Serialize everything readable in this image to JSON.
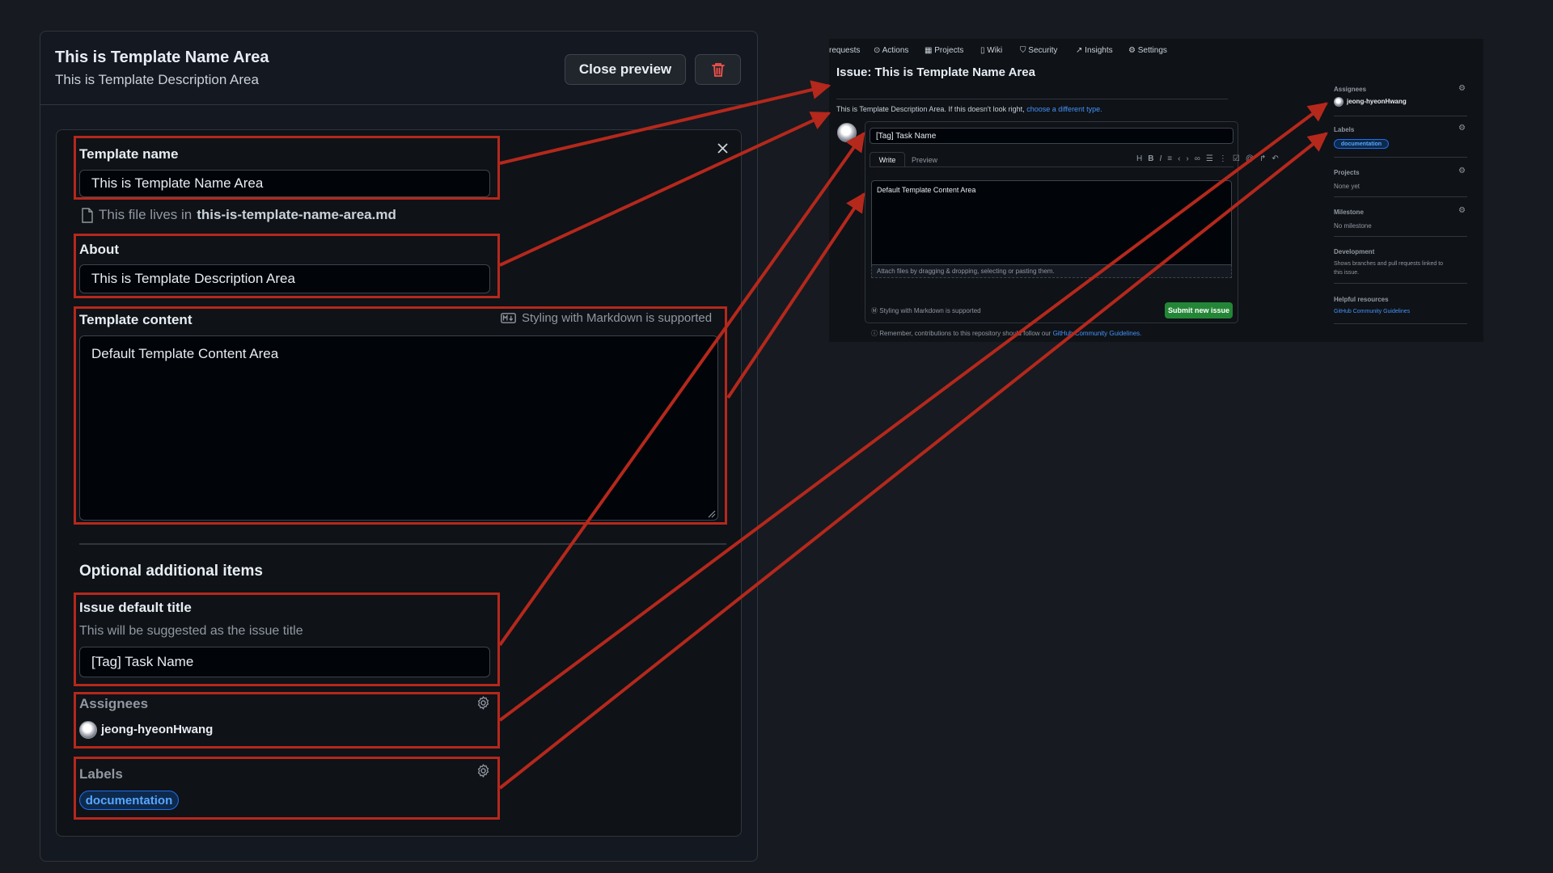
{
  "editor": {
    "title": "This is Template Name Area",
    "description": "This is Template Description Area",
    "close_preview_label": "Close preview",
    "template_name_label": "Template name",
    "template_name_value": "This is Template Name Area",
    "file_prefix": "This file lives in",
    "file_name": "this-is-template-name-area.md",
    "about_label": "About",
    "about_value": "This is Template Description Area",
    "content_label": "Template content",
    "markdown_note": "Styling with Markdown is supported",
    "content_value": "Default Template Content Area",
    "optional_heading": "Optional additional items",
    "issue_title_label": "Issue default title",
    "issue_title_hint": "This will be suggested as the issue title",
    "issue_title_value": "[Tag] Task Name",
    "assignees_label": "Assignees",
    "assignee_name": "jeong-hyeonHwang",
    "labels_label": "Labels",
    "label_chip": "documentation"
  },
  "preview": {
    "nav": [
      "requests",
      "Actions",
      "Projects",
      "Wiki",
      "Security",
      "Insights",
      "Settings"
    ],
    "issue_heading": "Issue: This is Template Name Area",
    "desc_text": "This is Template Description Area. If this doesn't look right,",
    "desc_link": "choose a different type.",
    "title_value": "[Tag] Task Name",
    "tab_write": "Write",
    "tab_preview": "Preview",
    "body_value": "Default Template Content Area",
    "attach_text": "Attach files by dragging & dropping, selecting or pasting them.",
    "markdown_note": "Styling with Markdown is supported",
    "submit_label": "Submit new issue",
    "remember_text": "Remember, contributions to this repository should follow our",
    "guidelines_link": "GitHub Community Guidelines.",
    "sidebar": {
      "assignees_h": "Assignees",
      "assignee": "jeong-hyeonHwang",
      "labels_h": "Labels",
      "label": "documentation",
      "projects_h": "Projects",
      "projects_v": "None yet",
      "milestone_h": "Milestone",
      "milestone_v": "No milestone",
      "dev_h": "Development",
      "dev_v1": "Shows branches and pull requests linked to",
      "dev_v2": "this issue.",
      "help_h": "Helpful resources",
      "help_link": "GitHub Community Guidelines"
    }
  },
  "colors": {
    "annotation_red": "#b5281c",
    "submit_green": "#238636",
    "link_blue": "#4493f8"
  }
}
